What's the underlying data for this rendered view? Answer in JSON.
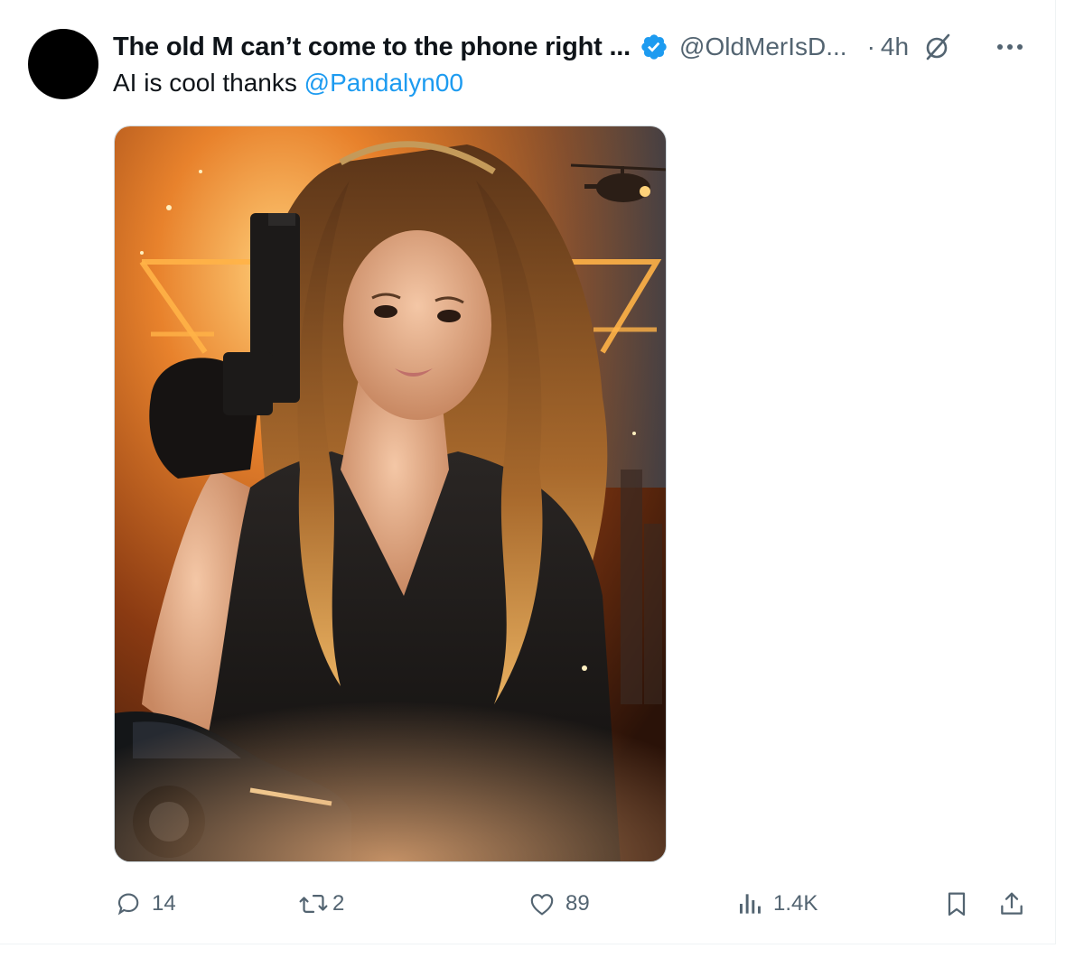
{
  "tweet": {
    "display_name": "The old M can’t come to the phone right ...",
    "handle": "@OldMerIsD...",
    "separator": "·",
    "time": "4h",
    "text_prefix": "AI is cool thanks ",
    "mention": "@Pandalyn00"
  },
  "actions": {
    "replies": "14",
    "reposts": "2",
    "likes": "89",
    "views": "1.4K"
  },
  "colors": {
    "accent": "#1d9bf0",
    "muted": "#536471",
    "text": "#0f1419"
  },
  "icons": [
    "verified-badge-icon",
    "grok-icon",
    "more-icon",
    "reply-icon",
    "repost-icon",
    "like-icon",
    "views-icon",
    "bookmark-icon",
    "share-icon"
  ]
}
